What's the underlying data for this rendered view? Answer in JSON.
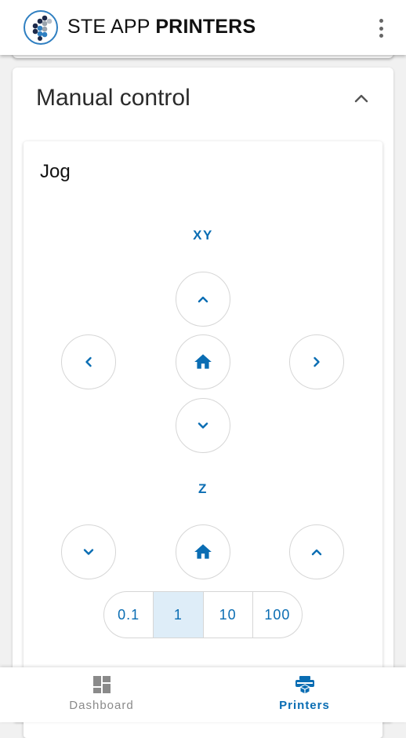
{
  "app": {
    "title_regular": "STE APP ",
    "title_bold": "PRINTERS",
    "brand_color": "#0a6db3",
    "icons": [
      "logo",
      "more-vert-icon"
    ]
  },
  "panel": {
    "title": "Manual control",
    "collapse_icon": "chevron-up-icon"
  },
  "jog": {
    "title": "Jog",
    "xy_label": "XY",
    "z_label": "Z",
    "buttons": {
      "xy_up": "chevron-up-icon",
      "xy_left": "chevron-left-icon",
      "xy_home": "home-icon",
      "xy_right": "chevron-right-icon",
      "xy_down": "chevron-down-icon",
      "z_down": "chevron-down-icon",
      "z_home": "home-icon",
      "z_up": "chevron-up-icon"
    },
    "steps": [
      "0.1",
      "1",
      "10",
      "100"
    ],
    "selected_step": "1"
  },
  "bottom_nav": {
    "items": [
      {
        "label": "Dashboard",
        "icon": "dashboard-icon",
        "active": false
      },
      {
        "label": "Printers",
        "icon": "printer-icon",
        "active": true
      }
    ]
  }
}
